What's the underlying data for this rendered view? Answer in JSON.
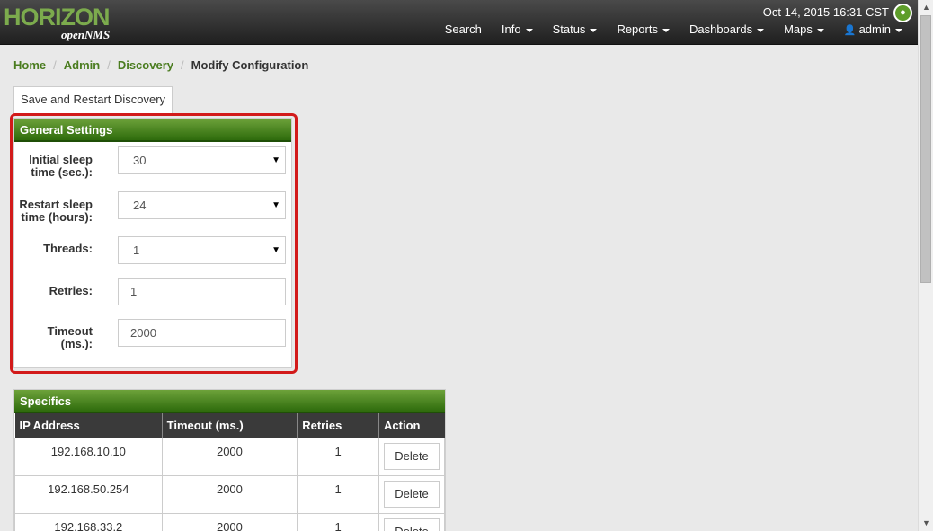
{
  "header": {
    "logo_text": "HORIZON",
    "logo_sub": "openNMS",
    "datetime": "Oct 14, 2015 16:31 CST",
    "bell_icon": "bell-icon",
    "nav": [
      {
        "label": "Search",
        "dropdown": false
      },
      {
        "label": "Info",
        "dropdown": true
      },
      {
        "label": "Status",
        "dropdown": true
      },
      {
        "label": "Reports",
        "dropdown": true
      },
      {
        "label": "Dashboards",
        "dropdown": true
      },
      {
        "label": "Maps",
        "dropdown": true
      },
      {
        "label": "admin",
        "dropdown": true,
        "icon": "user-icon"
      }
    ]
  },
  "breadcrumb": {
    "items": [
      "Home",
      "Admin",
      "Discovery"
    ],
    "current": "Modify Configuration"
  },
  "save_button": "Save and Restart Discovery",
  "general_settings": {
    "title": "General Settings",
    "fields": [
      {
        "label_line1": "Initial sleep",
        "label_line2": "time (sec.):",
        "value": "30",
        "type": "select"
      },
      {
        "label_line1": "Restart sleep",
        "label_line2": "time (hours):",
        "value": "24",
        "type": "select"
      },
      {
        "label_line1": "Threads:",
        "label_line2": "",
        "value": "1",
        "type": "select"
      },
      {
        "label_line1": "Retries:",
        "label_line2": "",
        "value": "1",
        "type": "text"
      },
      {
        "label_line1": "Timeout",
        "label_line2": "(ms.):",
        "value": "2000",
        "type": "text"
      }
    ]
  },
  "specifics": {
    "title": "Specifics",
    "columns": [
      "IP Address",
      "Timeout (ms.)",
      "Retries",
      "Action"
    ],
    "rows": [
      {
        "ip": "192.168.10.10",
        "timeout": "2000",
        "retries": "1",
        "action": "Delete"
      },
      {
        "ip": "192.168.50.254",
        "timeout": "2000",
        "retries": "1",
        "action": "Delete"
      },
      {
        "ip": "192.168.33.2",
        "timeout": "2000",
        "retries": "1",
        "action": "Delete"
      }
    ]
  },
  "colors": {
    "accent_green": "#4a7c1f",
    "panel_heading": "#2e6b0c",
    "highlight": "#d21a1a"
  }
}
